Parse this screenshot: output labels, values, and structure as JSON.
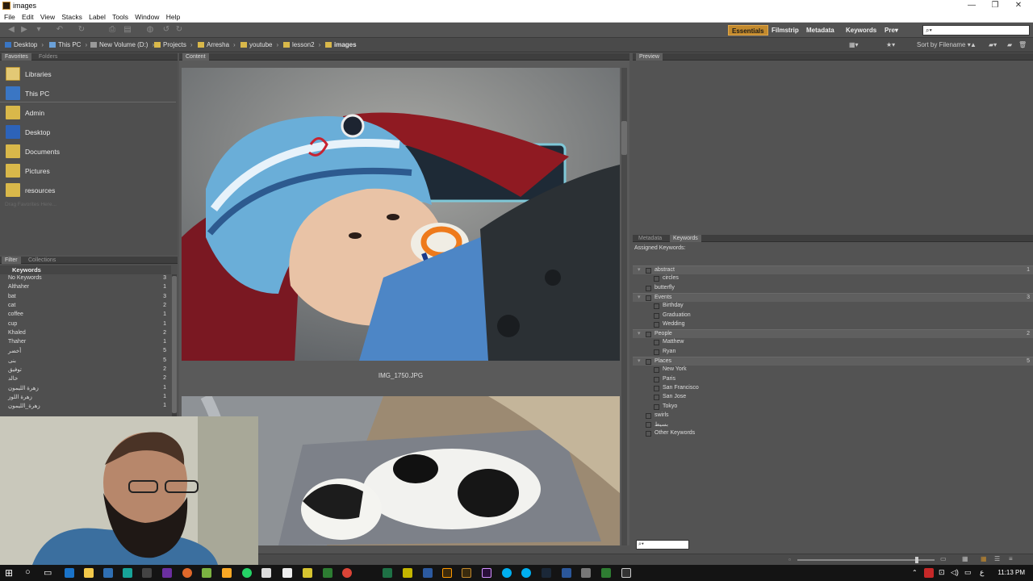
{
  "window": {
    "title": "images",
    "minimize": "—",
    "restore": "❐",
    "close": "✕"
  },
  "menu": [
    "File",
    "Edit",
    "View",
    "Stacks",
    "Label",
    "Tools",
    "Window",
    "Help"
  ],
  "workspaces": [
    "Essentials",
    "Filmstrip",
    "Metadata",
    "Keywords",
    "Pre▾"
  ],
  "search": {
    "placeholder": "",
    "icon": "search-icon"
  },
  "breadcrumb": [
    "Desktop",
    "This PC",
    "New Volume (D:)",
    "Projects",
    "Arresha",
    "youtube",
    "lesson2",
    "images"
  ],
  "sort": {
    "label": "Sort by Filename ▾"
  },
  "left_tabs": {
    "favorites": "Favorites",
    "folders": "Folders",
    "filter": "Filter",
    "collections": "Collections"
  },
  "favorites": [
    {
      "label": "Libraries",
      "icon": "libraries-icon"
    },
    {
      "label": "This PC",
      "icon": "computer-icon"
    },
    {
      "label": "Admin",
      "icon": "folder-icon"
    },
    {
      "label": "Desktop",
      "icon": "desktop-icon"
    },
    {
      "label": "Documents",
      "icon": "documents-icon"
    },
    {
      "label": "Pictures",
      "icon": "pictures-icon"
    },
    {
      "label": "resources",
      "icon": "folder-icon"
    }
  ],
  "favorites_hint": "Drag Favorites Here...",
  "filter": {
    "heading": "Keywords",
    "items": [
      {
        "name": "No Keywords",
        "count": "3"
      },
      {
        "name": "Althaher",
        "count": "1"
      },
      {
        "name": "bat",
        "count": "3"
      },
      {
        "name": "cat",
        "count": "2"
      },
      {
        "name": "coffee",
        "count": "1"
      },
      {
        "name": "cup",
        "count": "1"
      },
      {
        "name": "Khaled",
        "count": "2"
      },
      {
        "name": "Thaher",
        "count": "1"
      },
      {
        "name": "أخضر",
        "count": "5"
      },
      {
        "name": "بنى",
        "count": "5"
      },
      {
        "name": "توفيق",
        "count": "2"
      },
      {
        "name": "خالد",
        "count": "2"
      },
      {
        "name": "زهرة الليمون",
        "count": "1"
      },
      {
        "name": "زهرة اللوز",
        "count": "1"
      },
      {
        "name": "زهرة_الليمون",
        "count": "1"
      }
    ]
  },
  "content": {
    "tab": "Content",
    "caption1": "IMG_1750.JPG"
  },
  "preview": {
    "tab": "Preview"
  },
  "metadata_tabs": {
    "metadata": "Metadata",
    "keywords": "Keywords"
  },
  "assigned_label": "Assigned Keywords:",
  "keywords": [
    {
      "label": "abstract",
      "group": true,
      "count": "1"
    },
    {
      "label": "circles",
      "group": false,
      "count": ""
    },
    {
      "label": "butterfly",
      "group": false,
      "top": true,
      "count": ""
    },
    {
      "label": "Events",
      "group": true,
      "count": "3"
    },
    {
      "label": "Birthday",
      "group": false,
      "count": ""
    },
    {
      "label": "Graduation",
      "group": false,
      "count": ""
    },
    {
      "label": "Wedding",
      "group": false,
      "count": ""
    },
    {
      "label": "People",
      "group": true,
      "count": "2"
    },
    {
      "label": "Matthew",
      "group": false,
      "count": ""
    },
    {
      "label": "Ryan",
      "group": false,
      "count": ""
    },
    {
      "label": "Places",
      "group": true,
      "count": "5"
    },
    {
      "label": "New York",
      "group": false,
      "count": ""
    },
    {
      "label": "Paris",
      "group": false,
      "count": ""
    },
    {
      "label": "San Francisco",
      "group": false,
      "count": ""
    },
    {
      "label": "San Jose",
      "group": false,
      "count": ""
    },
    {
      "label": "Tokyo",
      "group": false,
      "count": ""
    },
    {
      "label": "swirls",
      "group": false,
      "top": true,
      "count": ""
    },
    {
      "label": "بسيط",
      "group": false,
      "top": true,
      "count": ""
    },
    {
      "label": "Other Keywords",
      "group": false,
      "top": true,
      "count": ""
    }
  ],
  "taskbar": {
    "clock": "11:13 PM",
    "lang": "ع"
  },
  "colors": {
    "accent": "#c38a2d",
    "panel": "#535353",
    "dark": "#3e3e3e"
  }
}
